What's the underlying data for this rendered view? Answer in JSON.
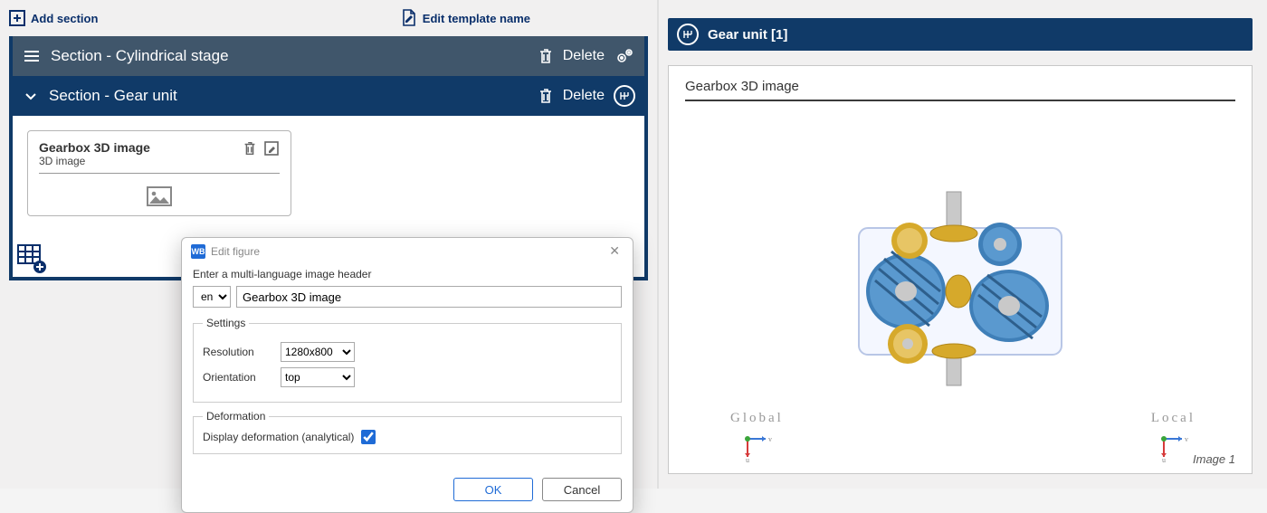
{
  "toolbar": {
    "add_section": "Add section",
    "edit_template_name": "Edit template name"
  },
  "sections": {
    "a_title": "Section - Cylindrical stage",
    "b_title": "Section - Gear unit",
    "delete_label": "Delete"
  },
  "card": {
    "title": "Gearbox 3D image",
    "subtitle": "3D image"
  },
  "dialog": {
    "app_badge": "WB",
    "window_title": "Edit figure",
    "prompt": "Enter a multi-language image header",
    "lang": "en",
    "header_value": "Gearbox 3D image",
    "group_settings": "Settings",
    "resolution_label": "Resolution",
    "resolution_value": "1280x800",
    "orientation_label": "Orientation",
    "orientation_value": "top",
    "group_deformation": "Deformation",
    "deformation_checkbox": "Display deformation (analytical)",
    "deformation_checked": true,
    "ok": "OK",
    "cancel": "Cancel"
  },
  "preview": {
    "header": "Gear unit [1]",
    "title": "Gearbox 3D image",
    "global_label": "Global",
    "local_label": "Local",
    "image_caption": "Image 1"
  }
}
